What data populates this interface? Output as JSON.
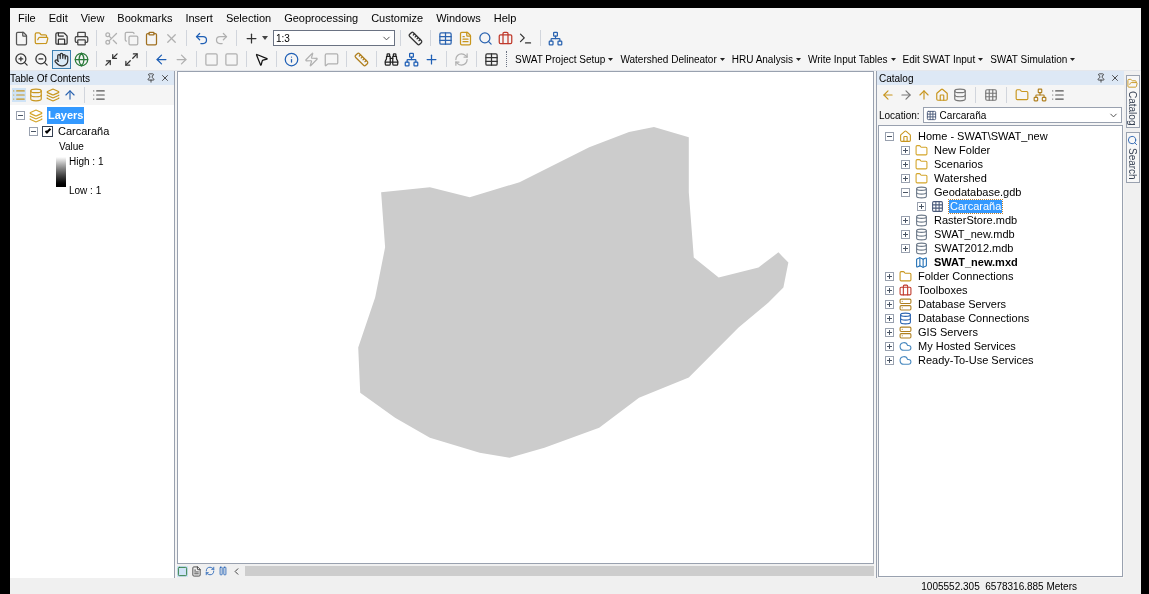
{
  "menu": [
    "File",
    "Edit",
    "View",
    "Bookmarks",
    "Insert",
    "Selection",
    "Geoprocessing",
    "Customize",
    "Windows",
    "Help"
  ],
  "standard_toolbar": {
    "scale": "1:3"
  },
  "swat_toolbar": [
    "SWAT Project Setup",
    "Watershed Delineator",
    "HRU Analysis",
    "Write Input Tables",
    "Edit SWAT Input",
    "SWAT Simulation"
  ],
  "toc": {
    "title": "Table Of Contents",
    "tree": [
      {
        "label": "Layers",
        "selected": true,
        "expanded": true,
        "children": [
          {
            "label": "Carcaraña",
            "selected": false,
            "expanded": true,
            "checked": true,
            "legend": {
              "title": "Value",
              "high": "High : 1",
              "low": "Low : 1"
            }
          }
        ]
      }
    ]
  },
  "catalog": {
    "title": "Catalog",
    "location_label": "Location:",
    "location": "Carcaraña",
    "tree": [
      {
        "label": "Home - SWAT\\SWAT_new",
        "kind": "home",
        "selected": false,
        "expanded": true,
        "children": [
          {
            "label": "New Folder",
            "kind": "folder",
            "selected": false,
            "expanded": false
          },
          {
            "label": "Scenarios",
            "kind": "folder",
            "selected": false,
            "expanded": false
          },
          {
            "label": "Watershed",
            "kind": "folder",
            "selected": false,
            "expanded": false
          },
          {
            "label": "Geodatabase.gdb",
            "kind": "database",
            "selected": false,
            "expanded": true,
            "children": [
              {
                "label": "Carcaraña",
                "kind": "raster",
                "selected": true,
                "expanded": false
              }
            ]
          },
          {
            "label": "RasterStore.mdb",
            "kind": "database",
            "selected": false,
            "expanded": false
          },
          {
            "label": "SWAT_new.mdb",
            "kind": "database",
            "selected": false,
            "expanded": false
          },
          {
            "label": "SWAT2012.mdb",
            "kind": "database",
            "selected": false,
            "expanded": false
          },
          {
            "label": "SWAT_new.mxd",
            "kind": "map",
            "selected": false
          }
        ]
      },
      {
        "label": "Folder Connections",
        "kind": "folder_connection",
        "selected": false,
        "expanded": false
      },
      {
        "label": "Toolboxes",
        "kind": "toolbox",
        "selected": false,
        "expanded": false
      },
      {
        "label": "Database Servers",
        "kind": "server",
        "selected": false,
        "expanded": false
      },
      {
        "label": "Database Connections",
        "kind": "connection",
        "selected": false,
        "expanded": false
      },
      {
        "label": "GIS Servers",
        "kind": "server",
        "selected": false,
        "expanded": false
      },
      {
        "label": "My Hosted Services",
        "kind": "cloud",
        "selected": false,
        "expanded": false
      },
      {
        "label": "Ready-To-Use Services",
        "kind": "cloud",
        "selected": false,
        "expanded": false
      }
    ]
  },
  "side_tabs": [
    "Catalog",
    "Search"
  ],
  "status_bar": {
    "coordinates": "1005552.305  6578316.885 Meters"
  }
}
